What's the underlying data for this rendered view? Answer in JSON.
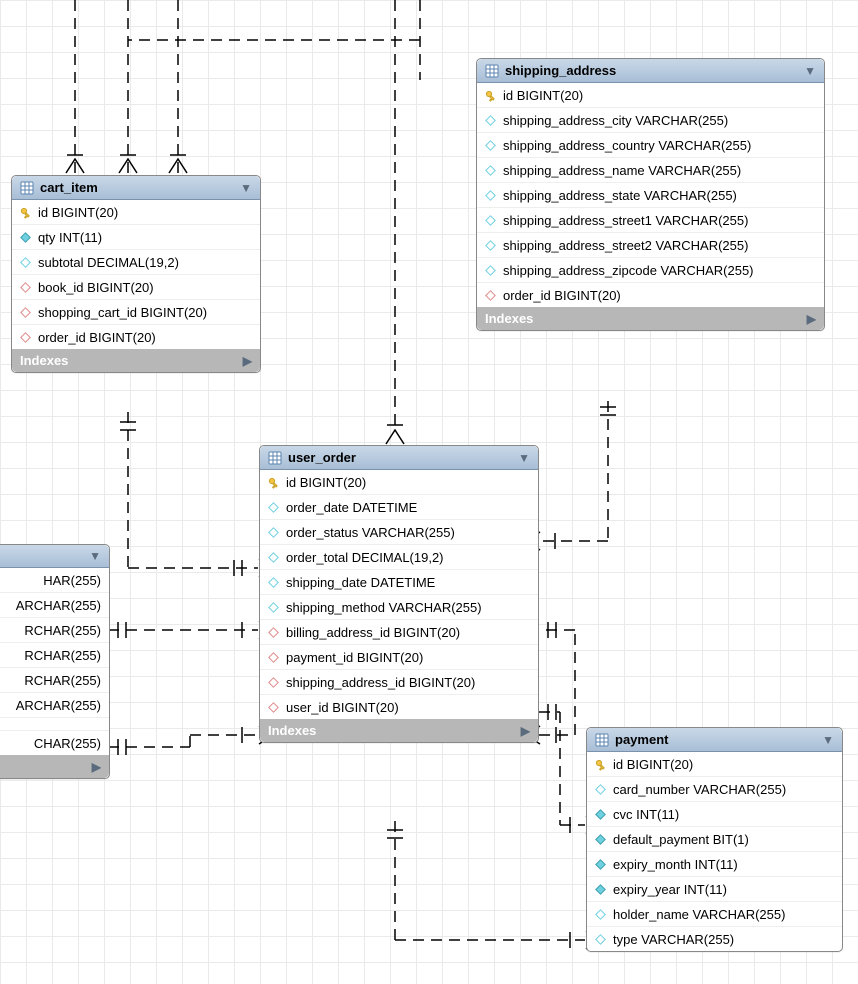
{
  "indexes_label": "Indexes",
  "tables": {
    "cart_item": {
      "title": "cart_item",
      "cols": [
        {
          "kind": "pk",
          "text": "id BIGINT(20)"
        },
        {
          "kind": "fill",
          "text": "qty INT(11)"
        },
        {
          "kind": "open",
          "text": "subtotal DECIMAL(19,2)"
        },
        {
          "kind": "fk",
          "text": "book_id BIGINT(20)"
        },
        {
          "kind": "fk",
          "text": "shopping_cart_id BIGINT(20)"
        },
        {
          "kind": "fk",
          "text": "order_id BIGINT(20)"
        }
      ]
    },
    "shipping_address": {
      "title": "shipping_address",
      "cols": [
        {
          "kind": "pk",
          "text": "id BIGINT(20)"
        },
        {
          "kind": "open",
          "text": "shipping_address_city VARCHAR(255)"
        },
        {
          "kind": "open",
          "text": "shipping_address_country VARCHAR(255)"
        },
        {
          "kind": "open",
          "text": "shipping_address_name VARCHAR(255)"
        },
        {
          "kind": "open",
          "text": "shipping_address_state VARCHAR(255)"
        },
        {
          "kind": "open",
          "text": "shipping_address_street1 VARCHAR(255)"
        },
        {
          "kind": "open",
          "text": "shipping_address_street2 VARCHAR(255)"
        },
        {
          "kind": "open",
          "text": "shipping_address_zipcode VARCHAR(255)"
        },
        {
          "kind": "fk",
          "text": "order_id BIGINT(20)"
        }
      ]
    },
    "user_order": {
      "title": "user_order",
      "cols": [
        {
          "kind": "pk",
          "text": "id BIGINT(20)"
        },
        {
          "kind": "open",
          "text": "order_date DATETIME"
        },
        {
          "kind": "open",
          "text": "order_status VARCHAR(255)"
        },
        {
          "kind": "open",
          "text": "order_total DECIMAL(19,2)"
        },
        {
          "kind": "open",
          "text": "shipping_date DATETIME"
        },
        {
          "kind": "open",
          "text": "shipping_method VARCHAR(255)"
        },
        {
          "kind": "fk",
          "text": "billing_address_id BIGINT(20)"
        },
        {
          "kind": "fk",
          "text": "payment_id BIGINT(20)"
        },
        {
          "kind": "fk",
          "text": "shipping_address_id BIGINT(20)"
        },
        {
          "kind": "fk",
          "text": "user_id BIGINT(20)"
        }
      ]
    },
    "payment": {
      "title": "payment",
      "cols": [
        {
          "kind": "pk",
          "text": "id BIGINT(20)"
        },
        {
          "kind": "open",
          "text": "card_number VARCHAR(255)"
        },
        {
          "kind": "fill",
          "text": "cvc INT(11)"
        },
        {
          "kind": "fill",
          "text": "default_payment BIT(1)"
        },
        {
          "kind": "fill",
          "text": "expiry_month INT(11)"
        },
        {
          "kind": "fill",
          "text": "expiry_year INT(11)"
        },
        {
          "kind": "open",
          "text": "holder_name VARCHAR(255)"
        },
        {
          "kind": "open",
          "text": "type VARCHAR(255)"
        }
      ]
    },
    "partial_left": {
      "title": "",
      "cols": [
        {
          "kind": "none",
          "text": "HAR(255)"
        },
        {
          "kind": "none",
          "text": "ARCHAR(255)"
        },
        {
          "kind": "none",
          "text": "RCHAR(255)"
        },
        {
          "kind": "none",
          "text": "RCHAR(255)"
        },
        {
          "kind": "none",
          "text": "RCHAR(255)"
        },
        {
          "kind": "none",
          "text": "ARCHAR(255)"
        },
        {
          "kind": "spacer",
          "text": ""
        },
        {
          "kind": "none",
          "text": "CHAR(255)"
        }
      ]
    }
  }
}
